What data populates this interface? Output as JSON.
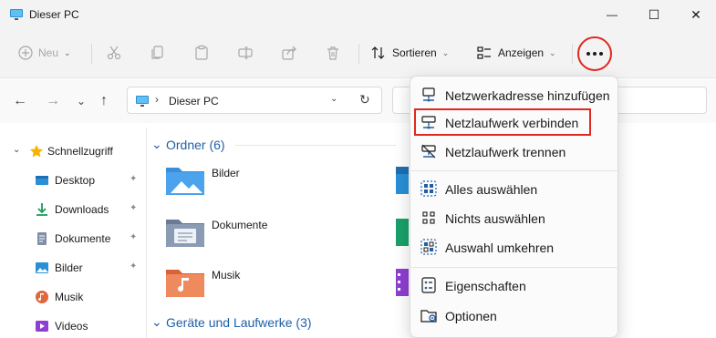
{
  "window": {
    "title": "Dieser PC"
  },
  "window_controls": {
    "minimize": "—",
    "maximize": "☐",
    "close": "✕"
  },
  "commandbar": {
    "new_label": "Neu",
    "sort_label": "Sortieren",
    "view_label": "Anzeigen"
  },
  "navigation": {
    "back": "←",
    "forward": "→",
    "recent": "⌄",
    "up": "↑",
    "address_separator": "›",
    "address_path": "Dieser PC",
    "address_dropdown": "⌄",
    "refresh": "↻"
  },
  "sidebar": {
    "quick_access": "Schnellzugriff",
    "items": [
      {
        "label": "Desktop",
        "pinned": true
      },
      {
        "label": "Downloads",
        "pinned": true
      },
      {
        "label": "Dokumente",
        "pinned": true
      },
      {
        "label": "Bilder",
        "pinned": true
      },
      {
        "label": "Musik",
        "pinned": false
      },
      {
        "label": "Videos",
        "pinned": false
      }
    ],
    "pin_glyph": "📌"
  },
  "content": {
    "folders_header": "Ordner (6)",
    "folders": [
      "Bilder",
      "Dokumente",
      "Musik"
    ],
    "drives_header": "Geräte und Laufwerke (3)",
    "group_chevron": "⌄"
  },
  "more_menu": {
    "items": [
      {
        "label": "Netzwerkadresse hinzufügen",
        "icon": "network-location-icon"
      },
      {
        "label": "Netzlaufwerk verbinden",
        "icon": "map-drive-icon",
        "highlighted": true
      },
      {
        "label": "Netzlaufwerk trennen",
        "icon": "disconnect-drive-icon"
      },
      {
        "label": "Alles auswählen",
        "icon": "select-all-icon"
      },
      {
        "label": "Nichts auswählen",
        "icon": "select-none-icon"
      },
      {
        "label": "Auswahl umkehren",
        "icon": "invert-selection-icon"
      },
      {
        "label": "Eigenschaften",
        "icon": "properties-icon"
      },
      {
        "label": "Optionen",
        "icon": "options-icon"
      }
    ]
  },
  "colors": {
    "accent": "#1f5fa8",
    "highlight_red": "#e0281f",
    "folder_blue": "#3b8fd9"
  }
}
